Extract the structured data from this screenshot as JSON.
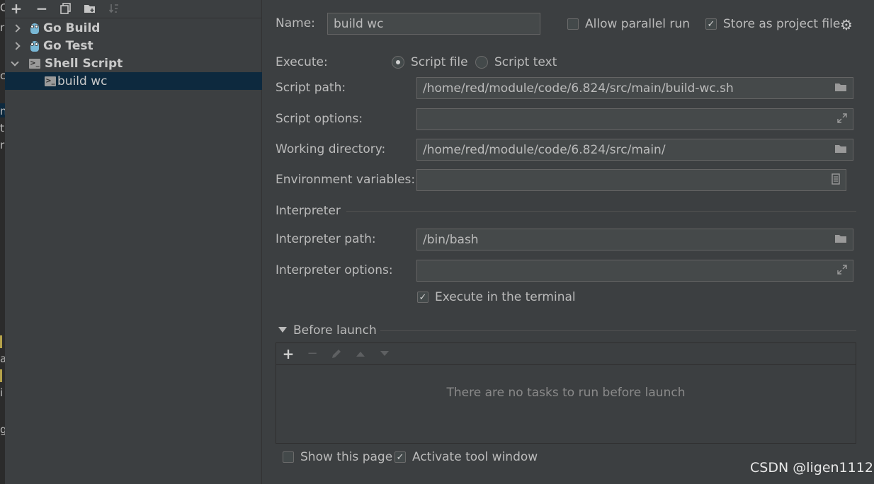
{
  "toolbar": {
    "add_icon": "plus-icon",
    "remove_icon": "minus-icon",
    "copy_icon": "copy-icon",
    "folder_icon": "new-folder-icon",
    "sort_icon": "sort-icon"
  },
  "tree": {
    "items": [
      {
        "label": "Go Build",
        "icon": "gopher-icon",
        "expanded": false
      },
      {
        "label": "Go Test",
        "icon": "gopher-icon",
        "expanded": false
      },
      {
        "label": "Shell Script",
        "icon": "shell-script-icon",
        "expanded": true
      },
      {
        "label": "build wc",
        "icon": "shell-script-icon",
        "selected": true
      }
    ]
  },
  "form": {
    "name_label": "Name:",
    "name_value": "build wc",
    "allow_parallel_label": "Allow parallel run",
    "allow_parallel_checked": false,
    "store_project_label": "Store as project file",
    "store_project_checked": true,
    "execute_label": "Execute:",
    "script_file_label": "Script file",
    "script_text_label": "Script text",
    "execute_selected": "Script file",
    "script_path_label": "Script path:",
    "script_path_value": "/home/red/module/code/6.824/src/main/build-wc.sh",
    "script_options_label": "Script options:",
    "script_options_value": "",
    "working_dir_label": "Working directory:",
    "working_dir_value": "/home/red/module/code/6.824/src/main/",
    "env_vars_label": "Environment variables:",
    "env_vars_value": "",
    "interpreter_section": "Interpreter",
    "interpreter_path_label": "Interpreter path:",
    "interpreter_path_value": "/bin/bash",
    "interpreter_options_label": "Interpreter options:",
    "interpreter_options_value": "",
    "execute_terminal_label": "Execute in the terminal",
    "execute_terminal_checked": true
  },
  "before_launch": {
    "title": "Before launch",
    "empty_message": "There are no tasks to run before launch"
  },
  "footer": {
    "show_page_label": "Show this page",
    "show_page_checked": false,
    "activate_tool_label": "Activate tool window",
    "activate_tool_checked": true
  },
  "watermark": "CSDN @ligen1112",
  "colors": {
    "background": "#3c3f41",
    "selection": "#0d293e",
    "input_bg": "#45494a",
    "text": "#bbbbbb"
  }
}
